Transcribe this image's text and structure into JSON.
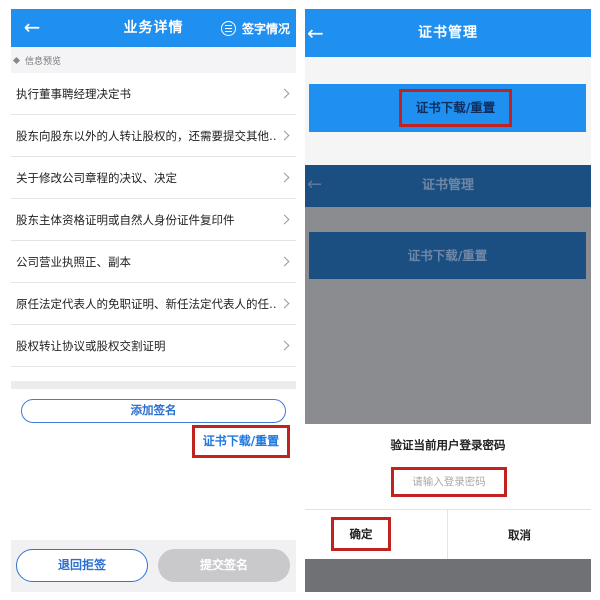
{
  "left": {
    "header": {
      "back_icon": "arrow-left-icon",
      "title": "业务详情",
      "sign_status_icon": "list-circle-icon",
      "sign_status_label": "签字情况"
    },
    "section_label": "信息预览",
    "items": [
      {
        "label": "执行董事聘经理决定书"
      },
      {
        "label": "股东向股东以外的人转让股权的，还需要提交其他…"
      },
      {
        "label": "关于修改公司章程的决议、决定"
      },
      {
        "label": "股东主体资格证明或自然人身份证件复印件"
      },
      {
        "label": "公司营业执照正、副本"
      },
      {
        "label": "原任法定代表人的免职证明、新任法定代表人的任…"
      },
      {
        "label": "股权转让协议或股权交割证明"
      }
    ],
    "add_sign_label": "添加签名",
    "cert_link_label": "证书下载/重置",
    "reject_label": "退回拒签",
    "submit_label": "提交签名"
  },
  "right": {
    "header": {
      "back_icon": "arrow-left-icon",
      "title": "证书管理"
    },
    "cert_button_label": "证书下载/重置",
    "overlay": {
      "title": "证书管理",
      "cert_button_label": "证书下载/重置"
    },
    "dialog": {
      "title": "验证当前用户登录密码",
      "password_placeholder": "请输入登录密码",
      "ok_label": "确定",
      "cancel_label": "取消"
    }
  },
  "colors": {
    "primary_blue": "#1f8ff0",
    "highlight_red": "#c0221f",
    "dimmed_blue": "#1b4f82",
    "overlay_gray": "#8a8c8f"
  }
}
